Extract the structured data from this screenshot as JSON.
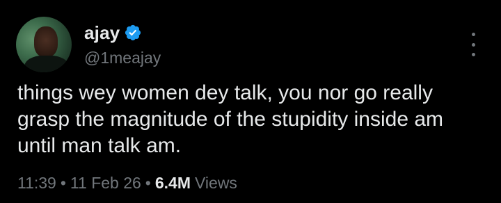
{
  "author": {
    "display_name": "ajay",
    "handle": "@1meajay",
    "verified": true,
    "verified_color": "#1d9bf0"
  },
  "tweet": {
    "text": "things wey women dey talk, you nor go really grasp the magnitude of the stupidity inside am until man talk am.",
    "time": "11:39",
    "date": "11 Feb 26",
    "separator": "•",
    "views_count": "6.4M",
    "views_label": "Views"
  },
  "icons": {
    "verified": "verified-badge-icon",
    "more": "more-options-icon"
  },
  "colors": {
    "background": "#000000",
    "primary_text": "#e7e9ea",
    "secondary_text": "#71767b"
  }
}
